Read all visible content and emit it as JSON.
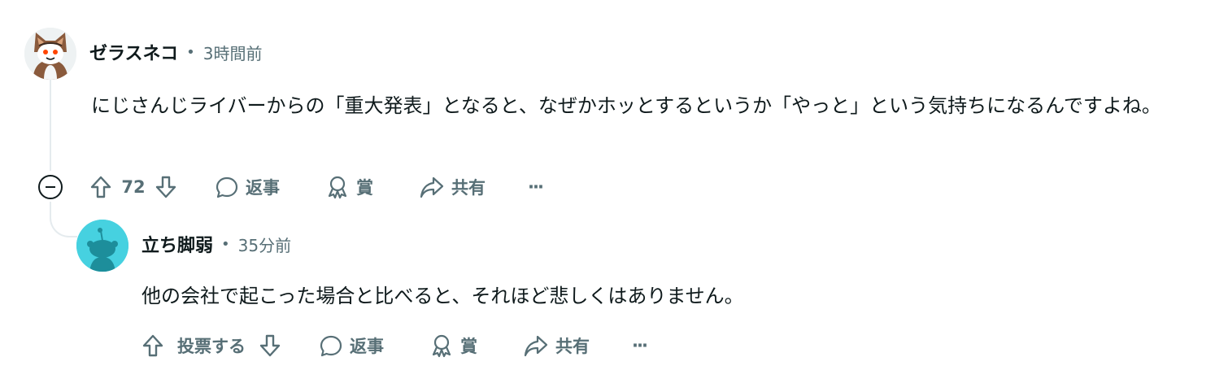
{
  "comment": {
    "author": "ゼラスネコ",
    "separator": "•",
    "timestamp": "3時間前",
    "body": "にじさんじライバーからの「重大発表」となると、なぜかホッとするというか「やっと」という気持ちになるんですよね。",
    "actions": {
      "vote_count": "72",
      "reply_label": "返事",
      "award_label": "賞",
      "share_label": "共有",
      "more_label": "···"
    }
  },
  "reply": {
    "author": "立ち脚弱",
    "separator": "•",
    "timestamp": "35分前",
    "body": "他の会社で起こった場合と比べると、それほど悲しくはありません。",
    "actions": {
      "vote_label": "投票する",
      "reply_label": "返事",
      "award_label": "賞",
      "share_label": "共有",
      "more_label": "···"
    }
  },
  "colors": {
    "text_primary": "#0f1a1c",
    "text_secondary": "#576f76",
    "thread_line": "#e5ebee",
    "reply_avatar_bg": "#46d1e0"
  },
  "icons": {
    "upvote": "arrow-up-icon",
    "downvote": "arrow-down-icon",
    "reply": "speech-bubble-icon",
    "award": "award-ribbon-icon",
    "share": "share-arrow-icon",
    "collapse": "minus-circle-icon",
    "more": "ellipsis-icon"
  }
}
